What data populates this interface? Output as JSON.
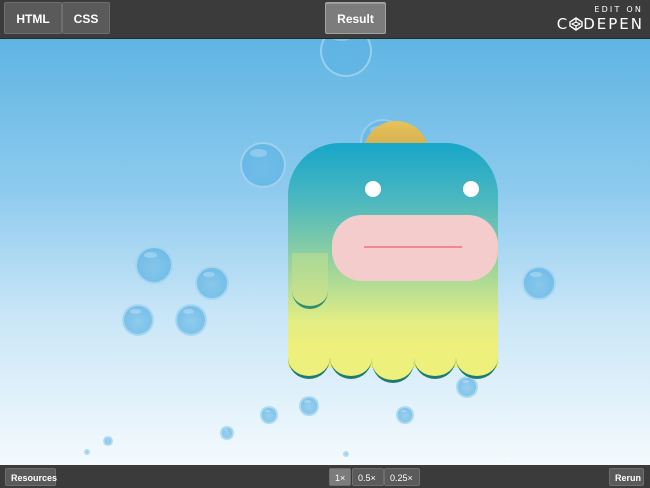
{
  "topbar": {
    "tabs": [
      {
        "label": "HTML"
      },
      {
        "label": "CSS"
      },
      {
        "label": "Result"
      }
    ],
    "codepen": {
      "edit_on": "EDIT ON",
      "brand": "C DEPEN"
    }
  },
  "bottombar": {
    "resources_label": "Resources",
    "zoom_options": [
      "1×",
      "0.5×",
      "0.25×"
    ],
    "zoom_selected": "1×",
    "rerun_label": "Rerun"
  },
  "colors": {
    "bar_bg": "#3b3b3b",
    "sky_top": "#5fb5e3",
    "sky_bottom": "#f4fafd",
    "monster_top": "#17a6c9",
    "monster_bottom": "#eef07c",
    "mouth": "#f5cccc"
  }
}
